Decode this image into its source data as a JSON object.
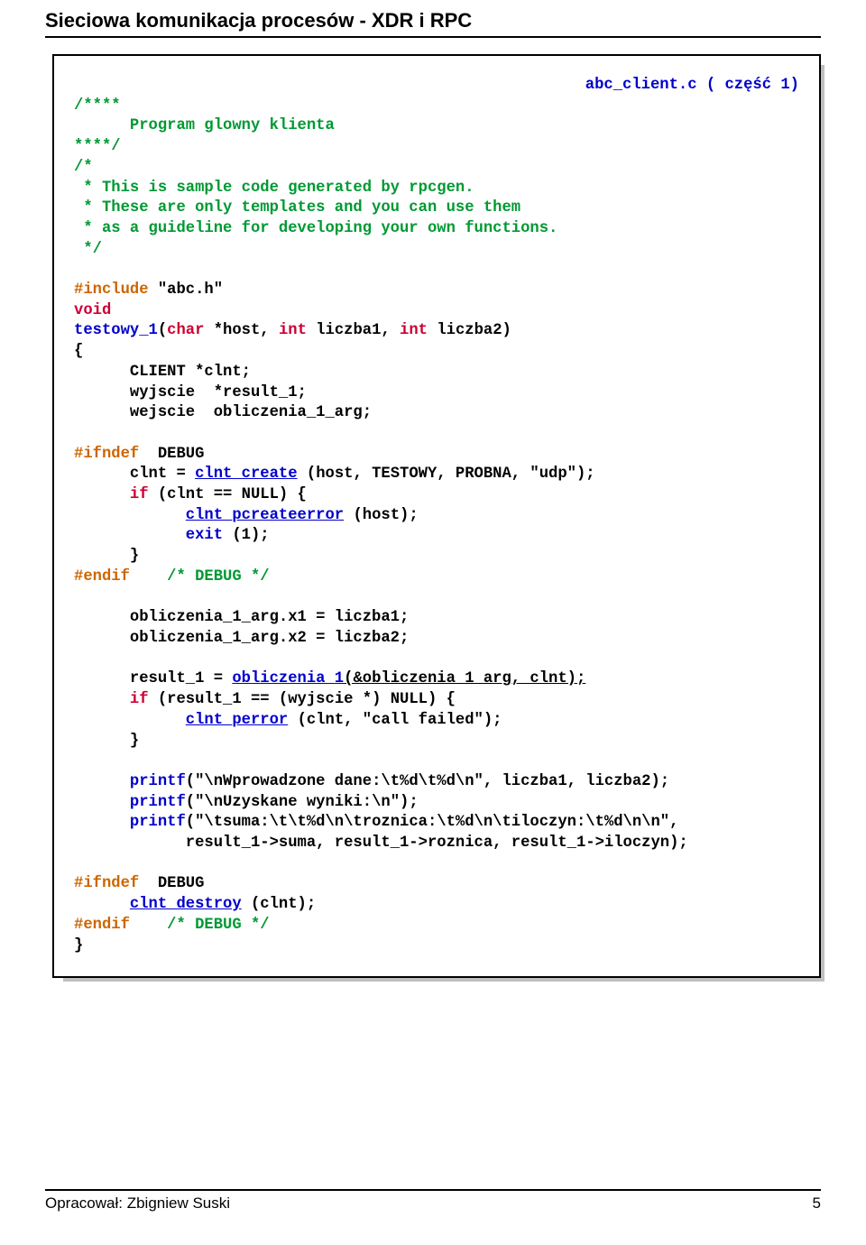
{
  "header": {
    "title": "Sieciowa komunikacja procesów - XDR i RPC"
  },
  "code": {
    "filename_label": "abc_client.c ( część 1)",
    "l01": "/****",
    "l02": "      Program glowny klienta",
    "l03": "****/",
    "l04": "/*",
    "l05": " * This is sample code generated by rpcgen.",
    "l06": " * These are only templates and you can use them",
    "l07": " * as a guideline for developing your own functions.",
    "l08": " */",
    "l09a": "#include",
    "l09b": " \"abc.h\"",
    "l10": "void",
    "l11a": "testowy_1",
    "l11b": "(",
    "l11c": "char",
    "l11d": " *host, ",
    "l11e": "int",
    "l11f": " liczba1, ",
    "l11g": "int",
    "l11h": " liczba2)",
    "l12": "{",
    "l13": "      CLIENT *clnt;",
    "l14": "      wyjscie  *result_1;",
    "l15": "      wejscie  obliczenia_1_arg;",
    "l16a": "#ifndef",
    "l16b": "  DEBUG",
    "l17a": "      clnt = ",
    "l17b": "clnt_create",
    "l17c": " (host, TESTOWY, PROBNA, \"udp\");",
    "l18a": "      ",
    "l18b": "if",
    "l18c": " (clnt == NULL) {",
    "l19a": "            ",
    "l19b": "clnt_pcreateerror",
    "l19c": " (host);",
    "l20a": "            ",
    "l20b": "exit",
    "l20c": " (1);",
    "l21": "      }",
    "l22a": "#endif",
    "l22b": "    /* DEBUG */",
    "l23": "      obliczenia_1_arg.x1 = liczba1;",
    "l24": "      obliczenia_1_arg.x2 = liczba2;",
    "l25a": "      result_1 = ",
    "l25b": "obliczenia_1",
    "l25c": "(&obliczenia_1_arg, clnt);",
    "l26a": "      ",
    "l26b": "if",
    "l26c": " (result_1 == (wyjscie *) NULL) {",
    "l27a": "            ",
    "l27b": "clnt_perror",
    "l27c": " (clnt, \"call failed\");",
    "l28": "      }",
    "l29a": "      ",
    "l29b": "printf",
    "l29c": "(\"\\nWprowadzone dane:\\t%d\\t%d\\n\", liczba1, liczba2);",
    "l30a": "      ",
    "l30b": "printf",
    "l30c": "(\"\\nUzyskane wyniki:\\n\");",
    "l31a": "      ",
    "l31b": "printf",
    "l31c": "(\"\\tsuma:\\t\\t%d\\n\\troznica:\\t%d\\n\\tiloczyn:\\t%d\\n\\n\",",
    "l32": "            result_1->suma, result_1->roznica, result_1->iloczyn);",
    "l33a": "#ifndef",
    "l33b": "  DEBUG",
    "l34a": "      ",
    "l34b": "clnt_destroy",
    "l34c": " (clnt);",
    "l35a": "#endif",
    "l35b": "    /* DEBUG */",
    "l36": "}"
  },
  "footer": {
    "left": "Opracował: Zbigniew Suski",
    "right": "5"
  }
}
